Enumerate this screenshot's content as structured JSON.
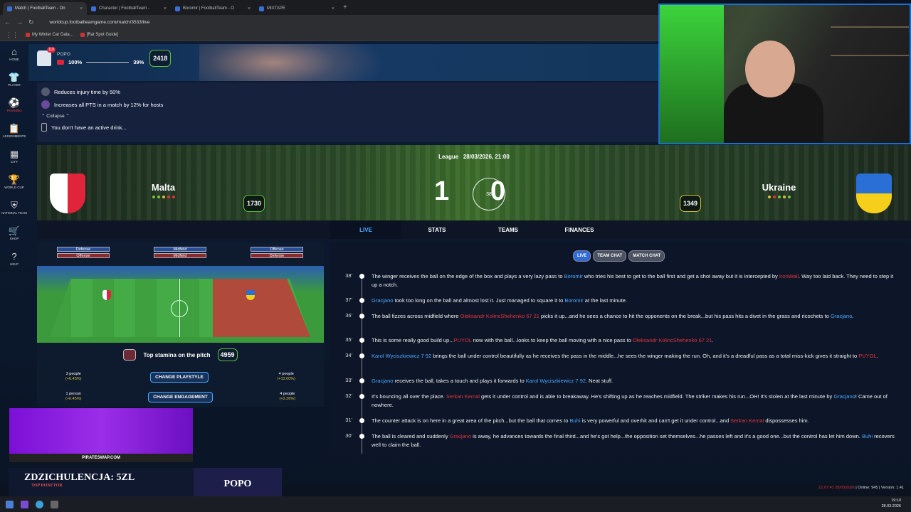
{
  "browser": {
    "tabs": [
      {
        "title": "Match | FootballTeam - On",
        "active": true
      },
      {
        "title": "Character | FootballTeam -",
        "active": false
      },
      {
        "title": "Boromir | FootballTeam - O",
        "active": false
      },
      {
        "title": "MIXTAPE",
        "active": false
      }
    ],
    "url": "worldcup.footballteamgame.com/match/3533/live",
    "bookmarks": [
      "My Winter Car Data...",
      "[Rat Spot Guide]"
    ]
  },
  "sidebar": [
    {
      "label": "HOME",
      "icon": "home-icon",
      "glyph": "⌂"
    },
    {
      "label": "PLAYER",
      "icon": "shirt-icon",
      "glyph": "👕"
    },
    {
      "label": "TRAINING",
      "icon": "ball-icon",
      "glyph": "⚽",
      "red": true
    },
    {
      "label": "ASSIGNMENTS",
      "icon": "clipboard-icon",
      "glyph": "📋"
    },
    {
      "label": "CITY",
      "icon": "city-icon",
      "glyph": "▦"
    },
    {
      "label": "WORLD CUP",
      "icon": "trophy-icon",
      "glyph": "🏆"
    },
    {
      "label": "NATIONAL TEAM",
      "icon": "national-icon",
      "glyph": "⛨"
    },
    {
      "label": "SHOP",
      "icon": "cart-icon",
      "glyph": "🛒"
    },
    {
      "label": "HELP",
      "icon": "help-icon",
      "glyph": "?"
    }
  ],
  "user": {
    "name": "POPO",
    "badge": "118",
    "stat_a": "100%",
    "stat_b": "39%",
    "score": "2418"
  },
  "perks": [
    "Reduces injury time by 50%",
    "Increases all PTS in a match by 12% for hosts"
  ],
  "collapse_label": "Collapse",
  "drink_text": "You don't have an active drink...",
  "match": {
    "league": "League",
    "date": "28/03/2026, 21:00",
    "home": {
      "name": "Malta",
      "rating": "1730",
      "score": "1"
    },
    "away": {
      "name": "Ukraine",
      "rating": "1349",
      "score": "0"
    },
    "minute": "38",
    "tabs": [
      "LIVE",
      "STATS",
      "TEAMS",
      "FINANCES"
    ]
  },
  "pitch": {
    "legend_left": [
      "Defense",
      "Offense"
    ],
    "legend_mid": [
      "Midfield",
      "Midfield"
    ],
    "legend_right": [
      "Offense",
      "Defense"
    ],
    "stamina_label": "Top stamina on the pitch",
    "stamina_value": "4959",
    "row1": {
      "left_people": "3 people",
      "left_pct": "(+6.45%)",
      "button": "CHANGE PLAYSTYLE",
      "right_people": "4 people",
      "right_pct": "(+12.00%)"
    },
    "row2": {
      "left_people": "1 person",
      "left_pct": "(+0.45%)",
      "button": "CHANGE ENGAGEMENT",
      "right_people": "4 people",
      "right_pct": "(+3.36%)"
    }
  },
  "comm_tabs": [
    "LIVE",
    "TEAM CHAT",
    "MATCH CHAT"
  ],
  "commentary": [
    {
      "min": "38'",
      "html": "The winger receives the ball on the edge of the box and plays a very lazy pass to <span class='hl'>Boromir</span> who tries his best to get to the ball first and get a shot away but it is intercepted by <span class='rd'>IronWall</span>. Way too laid back. They need to step it up a notch."
    },
    {
      "min": "37'",
      "html": "<span class='hl'>Gracjano</span> took too long on the ball and almost lost it. Just managed to square it to <span class='hl'>Boromir</span> at the last minute."
    },
    {
      "min": "36'",
      "html": "The ball fizzes across midfield where <span class='rd'>Oleksandr KolincShehenko 67 21</span> picks it up...and he sees a chance to hit the opponents on the break...but his pass hits a divet in the grass and ricochets to <span class='hl'>Gracjano</span>."
    },
    {
      "min": "35'",
      "html": "This is some really good build up...<span class='rd'>PUYOL</span> now with the ball...looks to keep the ball moving with a nice pass to <span class='rd'>Oleksandr KolincShehenko 67 21</span>."
    },
    {
      "min": "34'",
      "html": "<span class='hl'>Karol Wyciszkiewicz 7 92</span> brings the ball under control beautifully as he receives the pass in the middle...he sees the winger making the run. Oh, and it's a dreadful pass as a total miss-kick gives it straight to <span class='rd'>PUYOL</span>."
    },
    {
      "min": "33'",
      "html": "<span class='hl'>Gracjano</span> receives the ball, takes a touch and plays it forwards to <span class='hl'>Karol Wyciszkiewicz 7 92</span>. Neat stuff."
    },
    {
      "min": "32'",
      "html": "It's bouncing all over the place. <span class='rd'>Serkan Kemal</span> gets it under control and is able to breakaway. He's shifting up as he reaches midfield. The striker makes his run...OH! It's stolen at the last minute by <span class='hl'>Gracjano</span>! Came out of nowhere."
    },
    {
      "min": "31'",
      "html": "The counter attack is on here in a great area of the pitch...but the ball that comes to <span class='hl'>Buhi</span> is very powerful and overhit and can't get it under control...and <span class='rd'>Serkan Kemal</span> dispossesses him."
    },
    {
      "min": "30'",
      "html": "The ball is cleared and suddenly <span class='rd'>Gracjano</span> is away, he advances towards the final third...and he's got help...the opposition set themselves...he passes left and it's a good one...but the control has let him down. <span class='hl'>Buhi</span> recovers well to claim the ball."
    }
  ],
  "promo_label": "PIRATESWAP.COM",
  "donor": {
    "line1": "ZDZICHULENCJA: 5ZL",
    "line2": "TOP DONETOR",
    "name": "POPO"
  },
  "status": {
    "time": "21:07:41 28/03/2026",
    "online": "Online: 945",
    "version": "Version: 1.41"
  },
  "clock": {
    "time": "19:10",
    "date": "28.03.2026"
  },
  "colors": {
    "accent": "#4aa9ff",
    "opponent": "#e0343a",
    "hex_green": "#5fbf3a",
    "hex_gold": "#d9c13a"
  }
}
